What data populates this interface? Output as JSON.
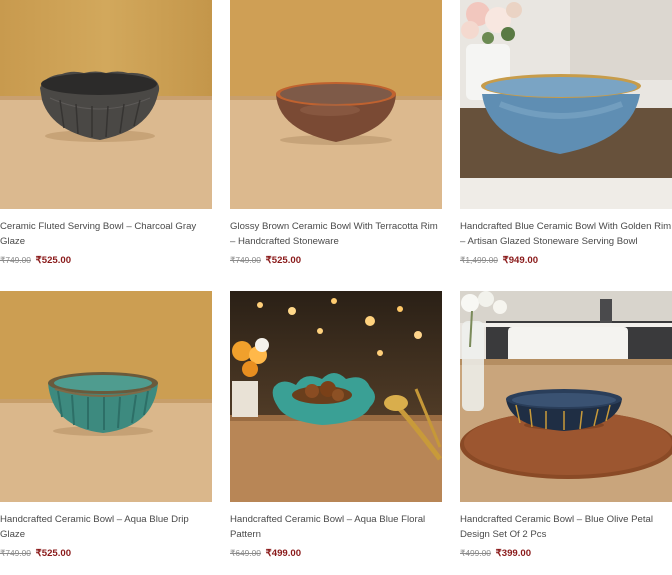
{
  "colors": {
    "price_sale": "#8a1a1a",
    "price_regular": "#8a8a8a",
    "title": "#4a4a4a"
  },
  "products": [
    {
      "title": "Ceramic Fluted Serving Bowl – Charcoal Gray Glaze",
      "old_price": "₹749.00",
      "price": "₹525.00"
    },
    {
      "title": "Glossy Brown Ceramic Bowl With Terracotta Rim – Handcrafted Stoneware",
      "old_price": "₹749.00",
      "price": "₹525.00"
    },
    {
      "title": "Handcrafted Blue Ceramic Bowl With Golden Rim – Artisan Glazed Stoneware Serving Bowl",
      "old_price": "₹1,499.00",
      "price": "₹949.00"
    },
    {
      "title": "Handcrafted Ceramic Bowl – Aqua Blue Drip Glaze",
      "old_price": "₹749.00",
      "price": "₹525.00"
    },
    {
      "title": "Handcrafted Ceramic Bowl – Aqua Blue Floral Pattern",
      "old_price": "₹649.00",
      "price": "₹499.00"
    },
    {
      "title": "Handcrafted Ceramic Bowl – Blue Olive Petal Design Set Of 2 Pcs",
      "old_price": "₹499.00",
      "price": "₹399.00"
    }
  ]
}
